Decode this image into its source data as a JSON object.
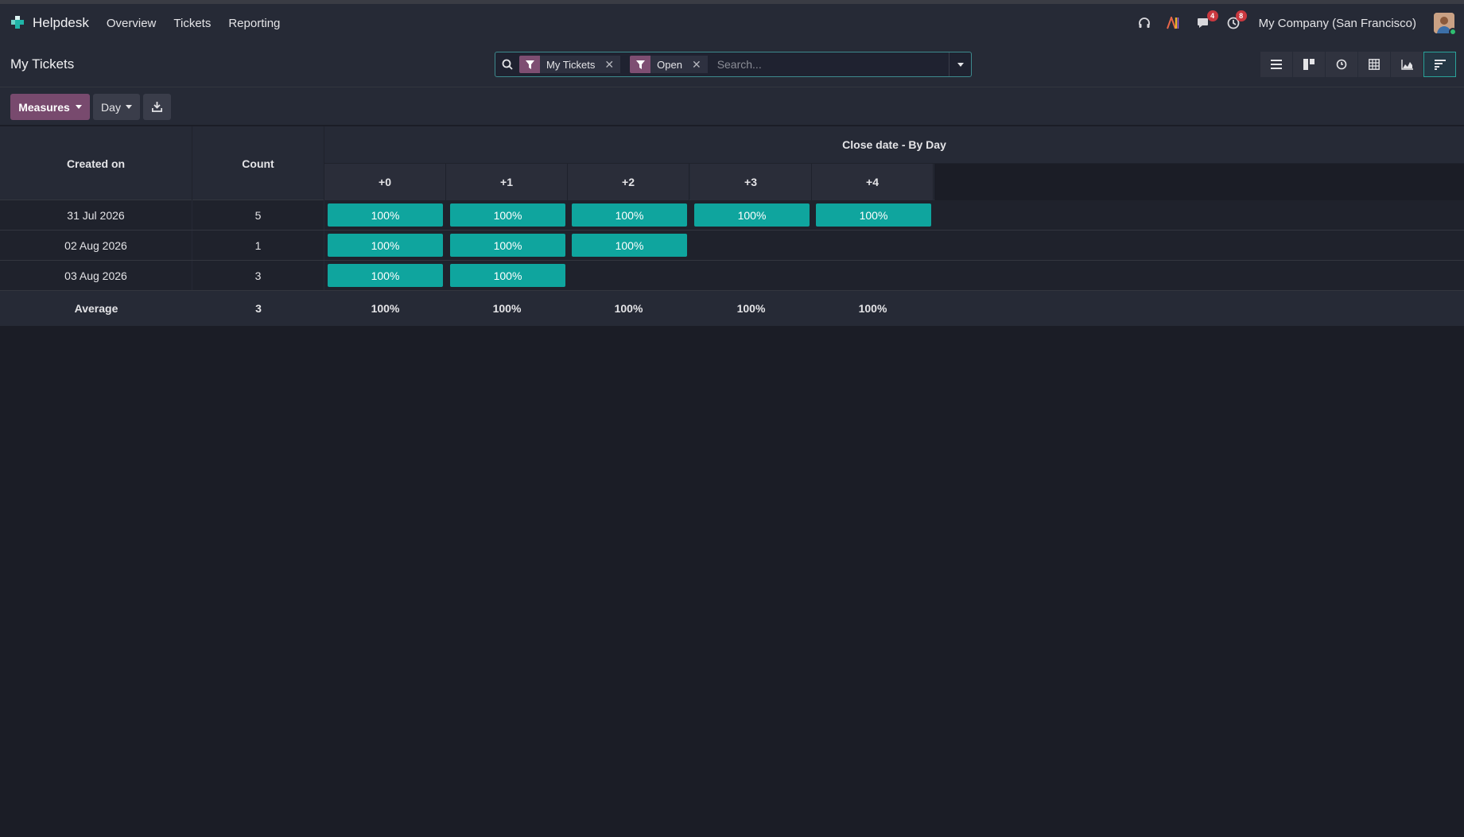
{
  "app": {
    "name": "Helpdesk"
  },
  "nav": {
    "items": [
      "Overview",
      "Tickets",
      "Reporting"
    ]
  },
  "systray": {
    "chat_badge": "4",
    "activity_badge": "8",
    "company": "My Company (San Francisco)"
  },
  "control": {
    "title": "My Tickets",
    "facets": [
      "My Tickets",
      "Open"
    ],
    "search_placeholder": "Search..."
  },
  "toolbar": {
    "measures_label": "Measures",
    "interval_label": "Day"
  },
  "cohort": {
    "row_header": "Created on",
    "measure_header": "Count",
    "group_header": "Close date - By Day",
    "columns": [
      "+0",
      "+1",
      "+2",
      "+3",
      "+4"
    ],
    "rows": [
      {
        "date": "31 Jul 2026",
        "count": "5",
        "cells": [
          "100%",
          "100%",
          "100%",
          "100%",
          "100%"
        ]
      },
      {
        "date": "02 Aug 2026",
        "count": "1",
        "cells": [
          "100%",
          "100%",
          "100%"
        ]
      },
      {
        "date": "03 Aug 2026",
        "count": "3",
        "cells": [
          "100%",
          "100%"
        ]
      }
    ],
    "footer": {
      "label": "Average",
      "count": "3",
      "values": [
        "100%",
        "100%",
        "100%",
        "100%",
        "100%"
      ]
    }
  },
  "colors": {
    "accent": "#784a6e",
    "cohort_fill": "#0fa59e",
    "background": "#1b1d26"
  }
}
